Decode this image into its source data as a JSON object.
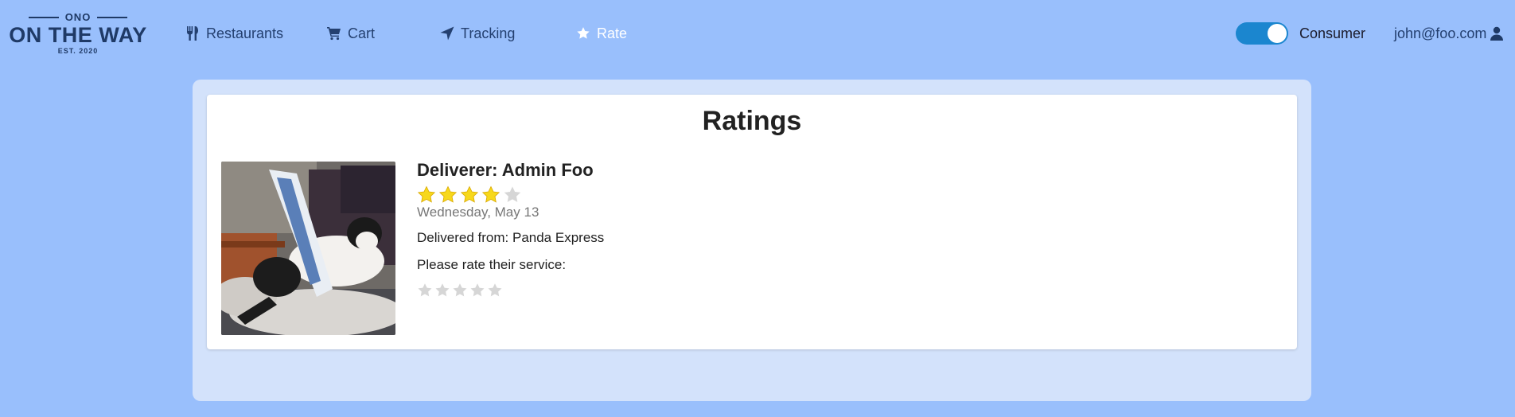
{
  "brand": {
    "top": "ONO",
    "name": "ON THE WAY",
    "est": "EST. 2020",
    "color": "#1f3a66"
  },
  "nav": {
    "restaurants": {
      "label": "Restaurants",
      "icon": "utensils-icon"
    },
    "cart": {
      "label": "Cart",
      "icon": "cart-icon"
    },
    "tracking": {
      "label": "Tracking",
      "icon": "location-arrow-icon"
    },
    "rate": {
      "label": "Rate",
      "icon": "star-icon",
      "active": true
    }
  },
  "mode": {
    "label": "Consumer",
    "toggle_on": true,
    "toggle_color": "#1b86cf"
  },
  "user": {
    "email": "john@foo.com",
    "icon": "user-icon"
  },
  "page": {
    "title": "Ratings",
    "background": "#99bffc"
  },
  "rating": {
    "deliverer": "Deliverer: Admin Foo",
    "stars": 4,
    "max_stars": 5,
    "date": "Wednesday, May 13",
    "from": "Delivered from: Panda Express",
    "prompt": "Please rate their service:",
    "user_rating": 0,
    "star_fill_color": "#f7d81b",
    "star_empty_color": "#d6d6d6"
  }
}
